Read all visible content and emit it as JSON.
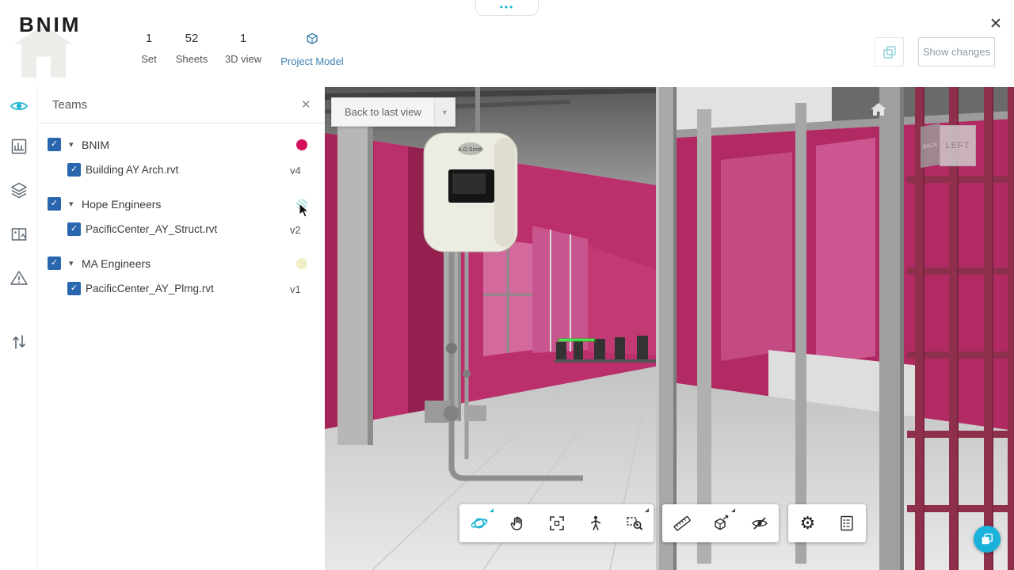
{
  "glyphs": {
    "check": "✓",
    "caret": "▾",
    "close": "✕",
    "dropdown": "▼",
    "menu_dots": "•••",
    "gear": "⚙"
  },
  "colors": {
    "accent_teal": "#19b4d2",
    "checkbox_blue": "#2a66ad",
    "link_blue": "#3c80ae",
    "wall_magenta": "#bb2f6d",
    "maroon_frame": "#8e2f4c",
    "team_bnim_dot": "#d4115c",
    "team_hope_dot": "#9adbd8",
    "team_ma_dot": "#f0ecc4"
  },
  "header": {
    "logo": "BNIM",
    "stats": [
      {
        "value": "1",
        "label": "Set"
      },
      {
        "value": "52",
        "label": "Sheets"
      },
      {
        "value": "1",
        "label": "3D view"
      }
    ],
    "project_model_label": "Project Model",
    "show_changes_label": "Show changes"
  },
  "left_toolbar": {
    "icons": [
      "views",
      "sheets",
      "layers",
      "media",
      "issues",
      "compare"
    ]
  },
  "teams": {
    "title": "Teams",
    "groups": [
      {
        "name": "BNIM",
        "dot_color": "#d4115c",
        "file": {
          "name": "Building AY Arch.rvt",
          "version": "v4"
        }
      },
      {
        "name": "Hope Engineers",
        "dot_color": "#9adbd8",
        "file": {
          "name": "PacificCenter_AY_Struct.rvt",
          "version": "v2"
        }
      },
      {
        "name": "MA Engineers",
        "dot_color": "#f0ecc4",
        "file": {
          "name": "PacificCenter_AY_Plmg.rvt",
          "version": "v1"
        }
      }
    ]
  },
  "viewport": {
    "back_button_label": "Back to last view",
    "viewcube": {
      "face_side": "BACK",
      "face_main": "LEFT"
    },
    "heater_brand": "A.O.Smith"
  },
  "bottom_toolbar": {
    "group_navigate": [
      "orbit",
      "pan",
      "fit-to-view",
      "first-person",
      "zoom-window"
    ],
    "group_tools": [
      "measure",
      "explode-model",
      "hide-isolate"
    ],
    "group_settings": [
      "settings",
      "model-browser"
    ]
  }
}
